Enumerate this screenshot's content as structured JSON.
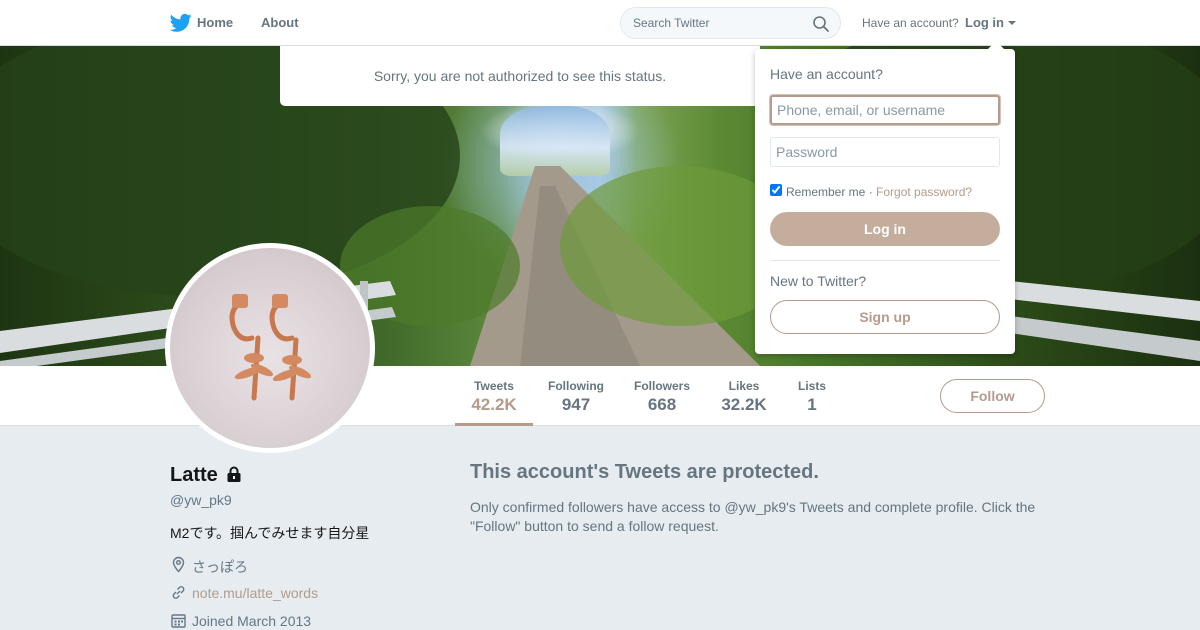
{
  "colors": {
    "accent": "#b49b8c",
    "twitter_blue": "#1da1f2",
    "text_muted": "#66757f",
    "background": "#e6ecf0"
  },
  "nav": {
    "logo_icon": "twitter-bird-icon",
    "home": "Home",
    "about": "About",
    "search_placeholder": "Search Twitter",
    "search_icon": "search-icon",
    "have_account": "Have an account?",
    "login": "Log in",
    "login_caret_icon": "caret-down-icon"
  },
  "status_message": "Sorry, you are not authorized to see this status.",
  "login_dropdown": {
    "heading": "Have an account?",
    "username_placeholder": "Phone, email, or username",
    "password_placeholder": "Password",
    "remember_me": "Remember me",
    "separator": " · ",
    "forgot_password": "Forgot password?",
    "remember_checked": true,
    "login_button": "Log in",
    "new_to_twitter": "New to Twitter?",
    "signup_button": "Sign up"
  },
  "stats": [
    {
      "label": "Tweets",
      "value": "42.2K",
      "active": true
    },
    {
      "label": "Following",
      "value": "947"
    },
    {
      "label": "Followers",
      "value": "668"
    },
    {
      "label": "Likes",
      "value": "32.2K"
    },
    {
      "label": "Lists",
      "value": "1"
    }
  ],
  "follow_button": "Follow",
  "profile": {
    "name": "Latte",
    "protected_icon": "lock-icon",
    "handle": "@yw_pk9",
    "bio": "M2です。掴んでみせます自分星",
    "location": "さっぽろ",
    "location_icon": "location-pin-icon",
    "website": "note.mu/latte_words",
    "website_icon": "link-icon",
    "joined": "Joined March 2013",
    "joined_icon": "calendar-icon"
  },
  "protected_notice": {
    "title": "This account's Tweets are protected.",
    "description": "Only confirmed followers have access to @yw_pk9's Tweets and complete profile. Click the \"Follow\" button to send a follow request."
  }
}
